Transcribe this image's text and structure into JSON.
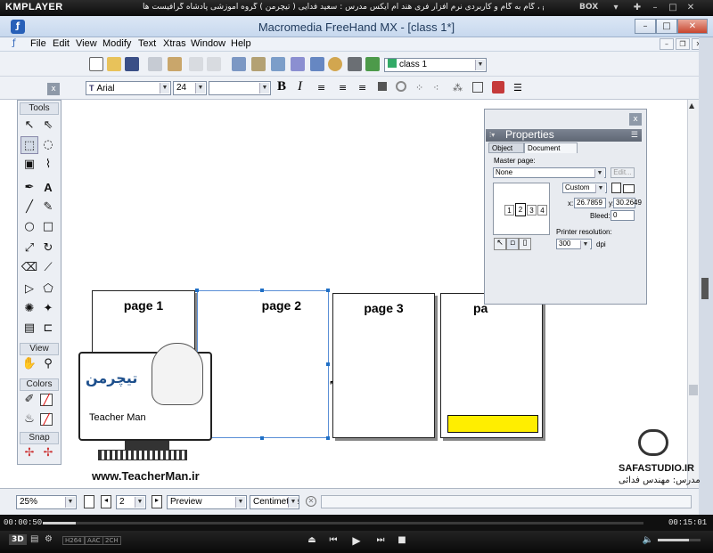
{
  "player": {
    "logo": "KMPLAYER",
    "title": "مجموعه آموزشی جامع ، گام به گام و کاربردی نرم افزار فری هند ام ایکس   مدرس : سعید فدایی ( تیچرمن ) گروه آموزشی پادشاه گرافیست ها",
    "box_label": "BOX",
    "time_elapsed": "00:00:50",
    "time_total": "00:15:01",
    "progress": 0.055,
    "volume": 0.72,
    "badges": [
      "H264",
      "AAC",
      "2CH"
    ],
    "btn_3d": "3D"
  },
  "app": {
    "window_title": "Macromedia FreeHand MX - [class 1*]",
    "menu": [
      "File",
      "Edit",
      "View",
      "Modify",
      "Text",
      "Xtras",
      "Window",
      "Help"
    ],
    "doc_dropdown": "class 1",
    "font_name": "Arial",
    "font_size": "24"
  },
  "tools_panel": {
    "title": "Tools",
    "view_title": "View",
    "colors_title": "Colors",
    "snap_title": "Snap"
  },
  "pages": [
    {
      "label": "page 1"
    },
    {
      "label": "page 2"
    },
    {
      "label": "page 3"
    },
    {
      "label": "pa"
    }
  ],
  "properties": {
    "title": "Properties",
    "tab_object": "Object",
    "tab_document": "Document",
    "master_page_label": "Master page:",
    "master_page_value": "None",
    "edit_btn": "Edit...",
    "size_value": "Custom",
    "x_label": "x:",
    "x_value": "26.7859",
    "y_label": "y:",
    "y_value": "30.2649",
    "bleed_label": "Bleed:",
    "bleed_value": "0",
    "thumbs": [
      "1",
      "2",
      "3",
      "4"
    ],
    "printer_res_label": "Printer resolution:",
    "printer_res_value": "300",
    "dpi_label": "dpi"
  },
  "status": {
    "zoom": "25%",
    "page_num": "2",
    "view_mode": "Preview",
    "units": "Centimeters"
  },
  "watermark": {
    "teacher_logo": "تیچرمن",
    "teacher_sub": "Teacher Man",
    "site": "www.TeacherMan.ir",
    "studio": "SAFASTUDIO.IR",
    "studio_sub": "مدرس: مهندس فدائی"
  },
  "colors": {
    "accent": "#1f6fc5",
    "yellow_block": "#ffee00"
  }
}
